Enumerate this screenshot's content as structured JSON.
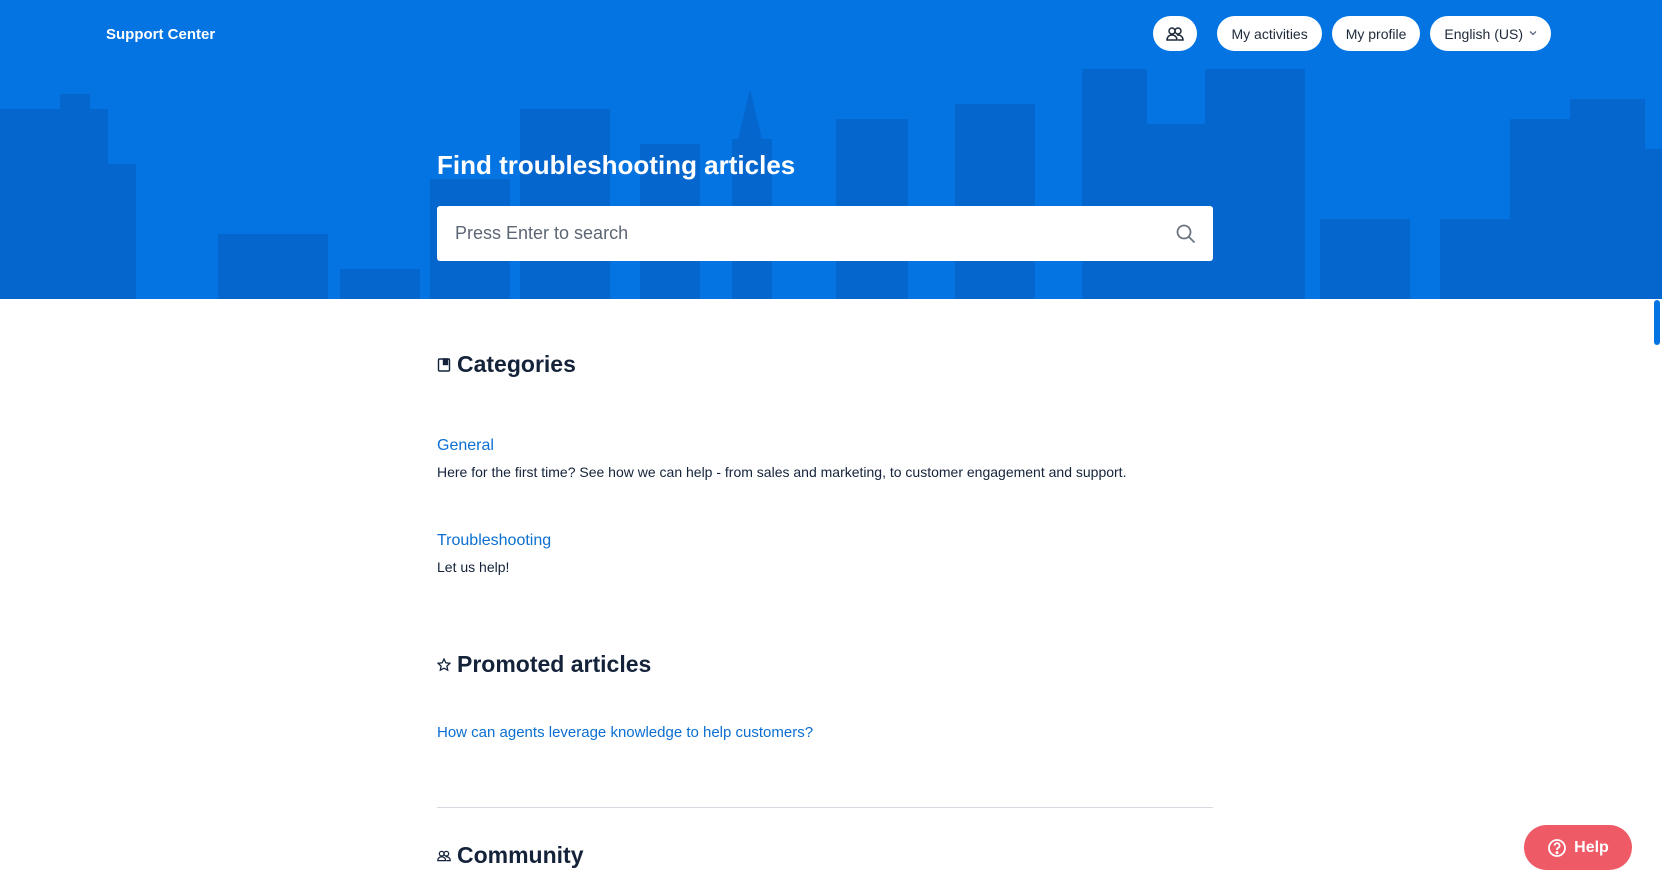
{
  "colors": {
    "brand_blue": "#0474e2",
    "link_blue": "#0b6fd1",
    "heading": "#14233a",
    "help_red": "#ee5a66"
  },
  "header": {
    "brand": "Support Center",
    "nav": {
      "community_icon": "people-icon",
      "activities": "My activities",
      "profile": "My profile",
      "language": "English (US)"
    }
  },
  "hero": {
    "title": "Find troubleshooting articles",
    "search_placeholder": "Press Enter to search"
  },
  "categories": {
    "title": "Categories",
    "icon": "book-icon",
    "items": [
      {
        "name": "General",
        "description": "Here for the first time? See how we can help - from sales and marketing, to customer engagement and support."
      },
      {
        "name": "Troubleshooting",
        "description": "Let us help!"
      }
    ]
  },
  "promoted": {
    "title": "Promoted articles",
    "icon": "star-icon",
    "articles": [
      "How can agents leverage knowledge to help customers?"
    ]
  },
  "community": {
    "title": "Community",
    "icon": "people-icon"
  },
  "help_button": {
    "label": "Help",
    "icon": "question-circle-icon"
  }
}
